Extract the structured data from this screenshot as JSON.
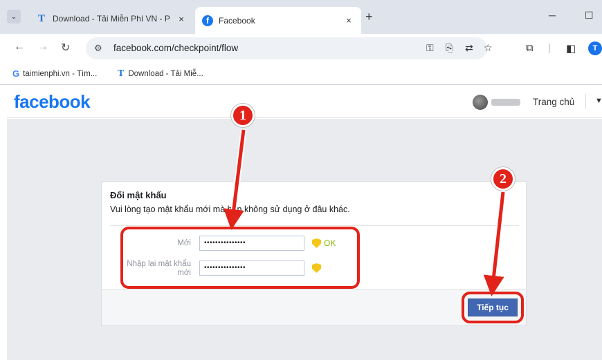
{
  "browser": {
    "tabs": [
      {
        "favicon": "T",
        "title": "Download - Tải Miễn Phí VN - P",
        "close": "×"
      },
      {
        "favicon": "f",
        "title": "Facebook",
        "close": "×"
      }
    ],
    "new_tab": "+",
    "url": "facebook.com/checkpoint/flow",
    "bookmarks": [
      {
        "icon": "G",
        "label": "taimienphi.vn - Tìm..."
      },
      {
        "icon": "T",
        "label": "Download - Tải Miễ..."
      }
    ],
    "profile_initial": "T"
  },
  "fb_header": {
    "logo": "facebook",
    "home_label": "Trang chủ"
  },
  "dialog": {
    "title": "Đổi mật khẩu",
    "description": "Vui lòng tạo mật khẩu mới mà bạn không sử dụng ở đâu khác.",
    "new_password_label": "Mới",
    "new_password_value": "•••••••••••••••",
    "confirm_label_line1": "Nhập lại mật khẩu",
    "confirm_label_line2": "mới",
    "confirm_password_value": "•••••••••••••••",
    "ok_text": "OK",
    "submit_label": "Tiếp tục"
  },
  "annotations": {
    "step1": "1",
    "step2": "2",
    "color": "#e2231a"
  },
  "colors": {
    "facebook_blue": "#1877f2",
    "button_blue": "#4267b2"
  }
}
